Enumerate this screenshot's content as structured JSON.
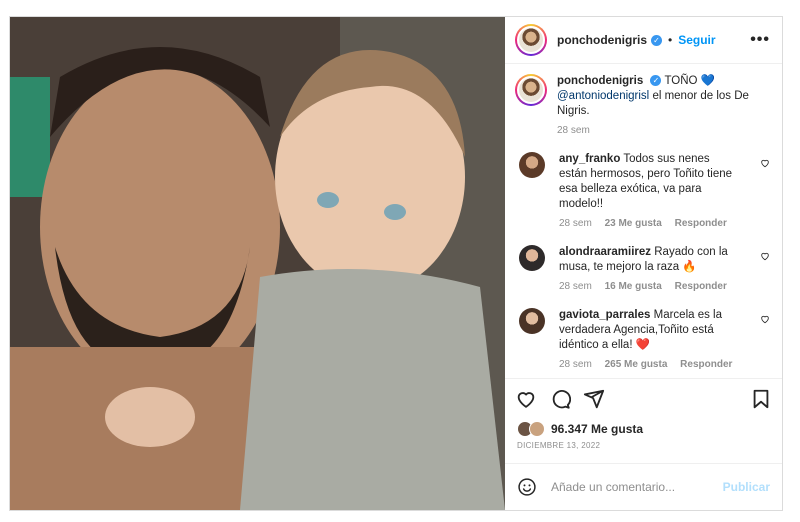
{
  "header": {
    "username": "ponchodenigris",
    "separator": "•",
    "follow_label": "Seguir",
    "more_label": "•••"
  },
  "caption": {
    "username": "ponchodenigris",
    "text_start": "TOÑO",
    "mention": "@antoniodenigrisl",
    "text_end": "el menor de los De Nigris.",
    "time": "28 sem"
  },
  "comments": [
    {
      "username": "any_franko",
      "text": "Todos sus nenes están hermosos, pero Toñito tiene esa belleza exótica, va para modelo!!",
      "time": "28 sem",
      "likes": "23 Me gusta",
      "reply": "Responder"
    },
    {
      "username": "alondraaramiirez",
      "text": "Rayado con la musa, te mejoro la raza",
      "time": "28 sem",
      "likes": "16 Me gusta",
      "reply": "Responder"
    },
    {
      "username": "gaviota_parrales",
      "text": "Marcela es la verdadera Agencia,Toñito está idéntico a ella!",
      "time": "28 sem",
      "likes": "265 Me gusta",
      "reply": "Responder"
    }
  ],
  "likes": {
    "count": "96.347",
    "label": "Me gusta"
  },
  "date": "DICIEMBRE 13, 2022",
  "add_comment": {
    "placeholder": "Añade un comentario...",
    "publish_label": "Publicar"
  },
  "icons": {
    "verified": "verified-badge-icon",
    "like": "heart-outline-icon",
    "comment": "speech-bubble-icon",
    "share": "paper-plane-icon",
    "save": "bookmark-icon",
    "emoji": "smiley-icon",
    "fire_emoji": "🔥",
    "red_heart_emoji": "❤️",
    "blue_heart_emoji": "💙"
  },
  "colors": {
    "accent": "#0095f6",
    "verified": "#3897f0",
    "muted": "#8e8e8e",
    "publish_disabled": "#b2dffc"
  }
}
